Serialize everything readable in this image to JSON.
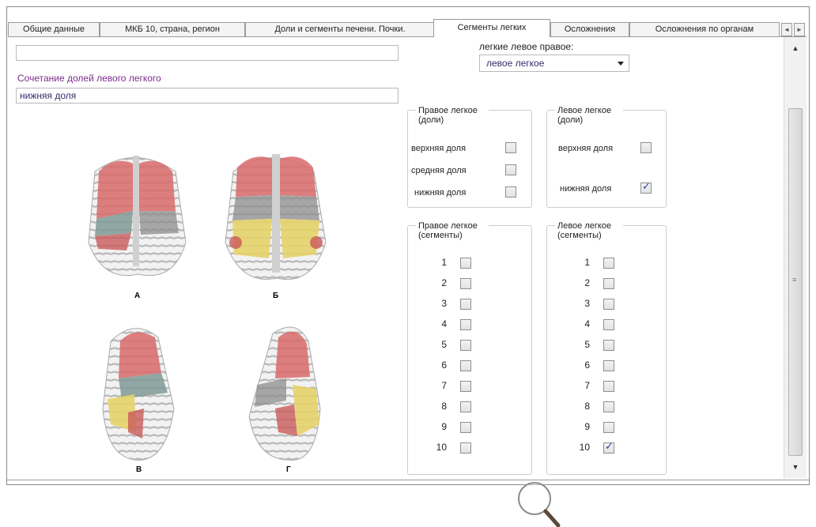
{
  "tabs": [
    {
      "label": "Общие данные"
    },
    {
      "label": "МКБ 10, страна, регион"
    },
    {
      "label": "Доли и сегменты печени. Почки."
    },
    {
      "label": "Сегменты легких"
    },
    {
      "label": "Осложнения"
    },
    {
      "label": "Осложнения по органам"
    }
  ],
  "top_textbox_value": "",
  "lobes_combo": {
    "label": "Сочетание долей левого легкого",
    "value": "нижняя доля"
  },
  "lung_select": {
    "label": "легкие левое правое:",
    "value": "левое легкое"
  },
  "right_lobes": {
    "title": "Правое легкое (доли)",
    "items": [
      {
        "label": "верхняя доля",
        "checked": false
      },
      {
        "label": "средняя доля",
        "checked": false
      },
      {
        "label": "нижняя доля",
        "checked": false
      }
    ]
  },
  "left_lobes": {
    "title": "Левое легкое (доли)",
    "items": [
      {
        "label": "верхняя доля",
        "checked": false
      },
      {
        "label": "нижняя доля",
        "checked": true
      }
    ]
  },
  "right_segments": {
    "title": "Правое легкое (сегменты)",
    "items": [
      "1",
      "2",
      "3",
      "4",
      "5",
      "6",
      "7",
      "8",
      "9",
      "10"
    ],
    "checked": []
  },
  "left_segments": {
    "title": "Левое легкое (сегменты)",
    "items": [
      "1",
      "2",
      "3",
      "4",
      "5",
      "6",
      "7",
      "8",
      "9",
      "10"
    ],
    "checked": [
      "10"
    ]
  },
  "figure_captions": {
    "a": "А",
    "b": "Б",
    "c": "В",
    "d": "Г"
  },
  "colors": {
    "upper": "#d86a6a",
    "middle": "#7f9a96",
    "lower": "#e6d36a"
  }
}
